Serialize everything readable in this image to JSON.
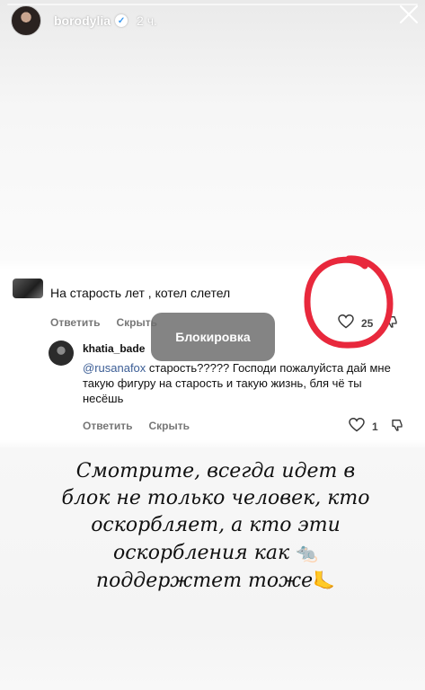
{
  "story": {
    "username": "borodylia",
    "time_ago": "2 ч."
  },
  "comment": {
    "text": "На старость лет , котел слетел",
    "reply_label": "Ответить",
    "hide_label": "Скрыть",
    "likes": "25"
  },
  "toast": {
    "label": "Блокировка"
  },
  "reply": {
    "username": "khatia_bade",
    "mention": "@rusanafox",
    "text": " старость????? Господи пожалуйста дай мне такую фигуру на старость и такую жизнь, бля чё ты несёшь",
    "reply_label": "Ответить",
    "hide_label": "Скрыть",
    "likes": "1"
  },
  "caption": {
    "line1": "Смотрите, всегда идет в",
    "line2": "блок не только человек, кто",
    "line3": "оскорбляет, а кто эти",
    "line4": "оскорбления как",
    "line4_emoji": "🐀",
    "line5": "поддержтет тоже",
    "line5_emoji": "🦶"
  },
  "colors": {
    "annotation_circle": "#e8283c",
    "mention": "#3b5d95",
    "toast_bg": "#6e6e6e"
  }
}
